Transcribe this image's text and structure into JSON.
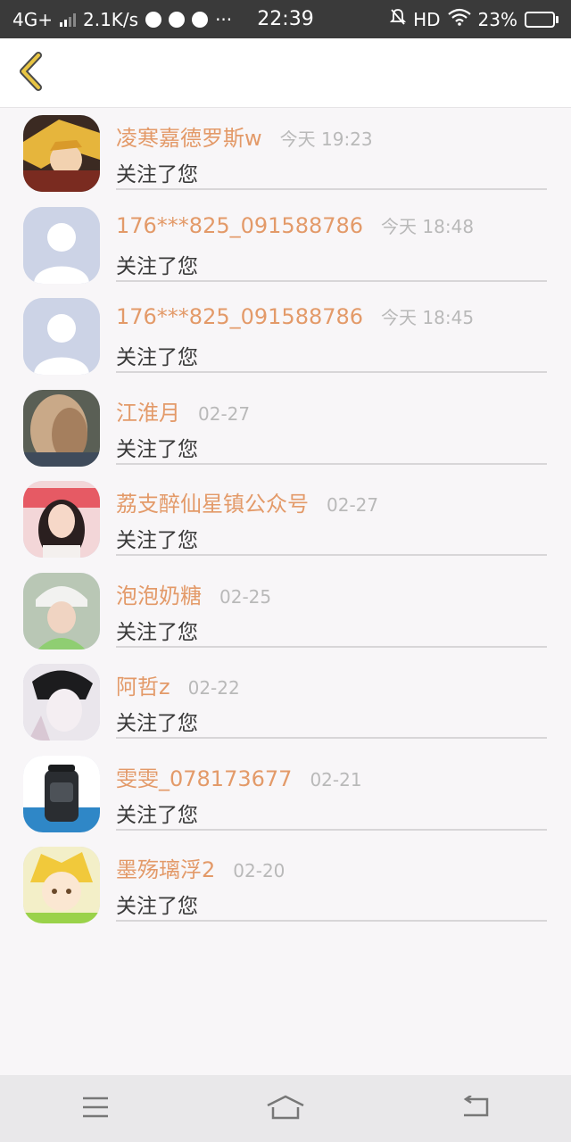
{
  "status_bar": {
    "network": "4G+",
    "speed": "2.1K/s",
    "more": "···",
    "time": "22:39",
    "hd": "HD",
    "battery_percent": "23%",
    "battery_level": 0.23
  },
  "header": {
    "back_icon": "chevron-left-icon",
    "accent": "#e8c543"
  },
  "list": {
    "items": [
      {
        "nickname": "凌寒嘉德罗斯w",
        "time": "今天 19:23",
        "action": "关注了您",
        "avatar": "anime-blond"
      },
      {
        "nickname": "176***825_091588786",
        "time": "今天 18:48",
        "action": "关注了您",
        "avatar": "default"
      },
      {
        "nickname": "176***825_091588786",
        "time": "今天 18:45",
        "action": "关注了您",
        "avatar": "default"
      },
      {
        "nickname": "江淮月",
        "time": "02-27",
        "action": "关注了您",
        "avatar": "photo-hair"
      },
      {
        "nickname": "荔支醉仙星镇公众号",
        "time": "02-27",
        "action": "关注了您",
        "avatar": "photo-girl-red"
      },
      {
        "nickname": "泡泡奶糖",
        "time": "02-25",
        "action": "关注了您",
        "avatar": "photo-girl-hat"
      },
      {
        "nickname": "阿哲z",
        "time": "02-22",
        "action": "关注了您",
        "avatar": "sketch-boy"
      },
      {
        "nickname": "雯雯_078173677",
        "time": "02-21",
        "action": "关注了您",
        "avatar": "backpack"
      },
      {
        "nickname": "墨殇璃浮2",
        "time": "02-20",
        "action": "关注了您",
        "avatar": "anime-chibi"
      }
    ]
  },
  "colors": {
    "nickname": "#e39a69",
    "time": "#b9b9b9",
    "action": "#3a3a3a",
    "background": "#f8f6f8"
  },
  "nav_bar": {
    "menu_icon": "menu-icon",
    "home_icon": "home-icon",
    "back_icon": "return-icon"
  }
}
